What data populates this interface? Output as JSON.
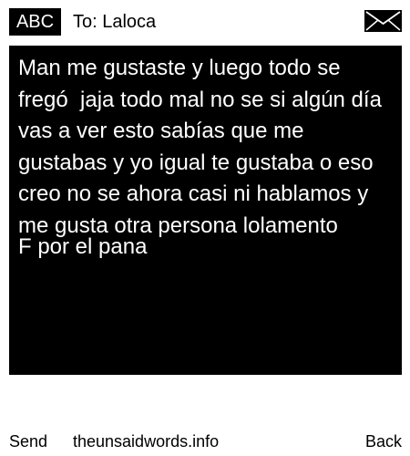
{
  "header": {
    "mode_label": "ABC",
    "recipient": "To: Laloca",
    "icon": "envelope-icon"
  },
  "message": {
    "body": "Man me gustaste y luego todo se fregó  jaja todo mal no se si algún día vas a ver esto sabías que me gustabas y yo igual te gustaba o eso creo no se ahora casi ni hablamos y me gusta otra persona lolamento",
    "signature": "F por el pana"
  },
  "footer": {
    "send_label": "Send",
    "site_label": "theunsaidwords.info",
    "back_label": "Back"
  },
  "colors": {
    "background": "#ffffff",
    "message_background": "#000000",
    "message_text": "#ffffff",
    "text": "#000000"
  }
}
